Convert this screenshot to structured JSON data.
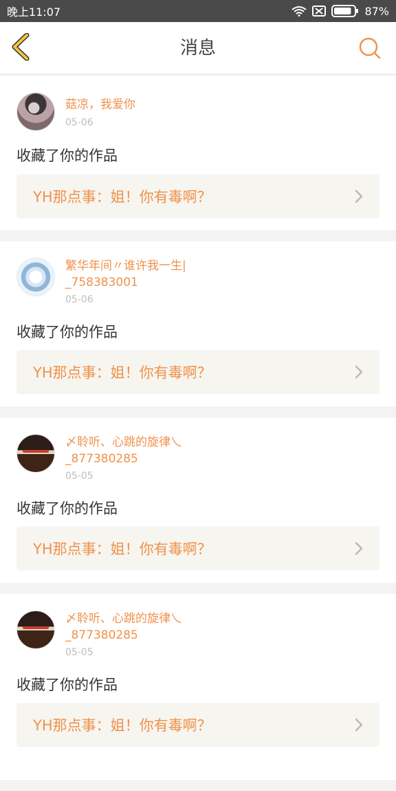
{
  "status_bar": {
    "time": "晚上11:07",
    "battery": "87%",
    "battery_level": 0.87
  },
  "header": {
    "title": "消息"
  },
  "messages": [
    {
      "username": "菇凉，我爱你",
      "date": "05-06",
      "action": "收藏了你的作品",
      "work_title": "YH那点事：姐！你有毒啊？"
    },
    {
      "username": "繁华年间〃谁许我一生|",
      "username_line2": "_758383001",
      "date": "05-06",
      "action": "收藏了你的作品",
      "work_title": "YH那点事：姐！你有毒啊？"
    },
    {
      "username": "〆聆听、心跳的旋律乀",
      "username_line2": "_877380285",
      "date": "05-05",
      "action": "收藏了你的作品",
      "work_title": "YH那点事：姐！你有毒啊？"
    },
    {
      "username": "〆聆听、心跳的旋律乀",
      "username_line2": "_877380285",
      "date": "05-05",
      "action": "收藏了你的作品",
      "work_title": "YH那点事：姐！你有毒啊？"
    }
  ],
  "colors": {
    "accent": "#f0914b",
    "back_icon": "#f2c642",
    "status_bar_bg": "#4a4a4a",
    "card_bg": "#ffffff",
    "link_bg": "#f6f5ef",
    "date": "#bdbdbd"
  },
  "icons": {
    "back": "chevron-left-icon",
    "search": "search-icon",
    "wifi": "wifi-icon",
    "signal_off": "no-signal-icon",
    "battery": "battery-icon"
  }
}
